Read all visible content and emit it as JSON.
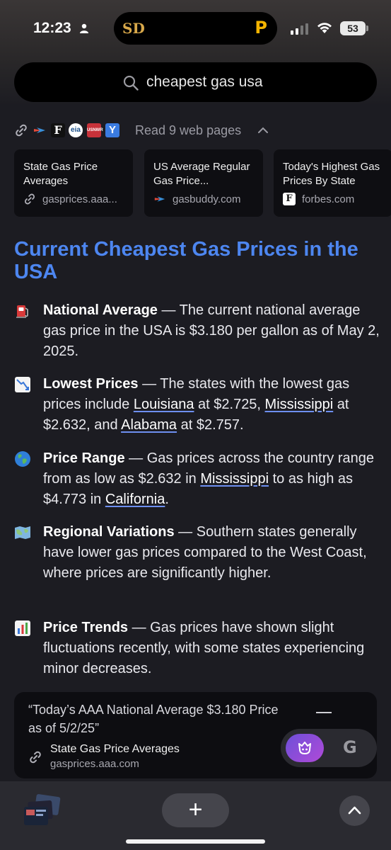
{
  "status_bar": {
    "time": "12:23",
    "battery": "53"
  },
  "search": {
    "query": "cheapest gas usa"
  },
  "sources": {
    "summary": "Read 9 web pages",
    "icons": [
      "link-icon",
      "gasbuddy-icon",
      "forbes-icon",
      "eia-icon",
      "usnews-icon",
      "yahoo-icon"
    ],
    "cards": [
      {
        "title": "State Gas Price Averages",
        "site": "gasprices.aaa..."
      },
      {
        "title": "US Average Regular Gas Price...",
        "site": "gasbuddy.com"
      },
      {
        "title": "Today's Highest Gas Prices By State",
        "site": "forbes.com"
      }
    ]
  },
  "answer": {
    "heading": "Current Cheapest Gas Prices in the USA",
    "items": [
      {
        "icon": "fuel-pump-icon",
        "title": "National Average",
        "text": " — The current national average gas price in the USA is $3.180 per gallon as of May 2, 2025."
      },
      {
        "icon": "chart-decreasing-icon",
        "title": "Lowest Prices",
        "t1": " — The states with the lowest gas prices include ",
        "l1": "Louisiana",
        "t2": " at $2.725, ",
        "l2": "Mississippi",
        "t3": " at $2.632, and ",
        "l3": "Alabama",
        "t4": " at $2.757."
      },
      {
        "icon": "globe-icon",
        "title": "Price Range",
        "t1": " — Gas prices across the country range from as low as $2.632 in ",
        "l1": "Mississippi",
        "t2": " to as high as $4.773 in ",
        "l2": "California",
        "t3": "."
      },
      {
        "icon": "map-icon",
        "title": "Regional Variations",
        "text": " — Southern states generally have lower gas prices compared to the West Coast, where prices are significantly higher."
      },
      {
        "icon": "bar-chart-icon",
        "title": "Price Trends",
        "text": " — Gas prices have shown slight fluctuations recently, with some states experiencing minor decreases."
      }
    ]
  },
  "quote": {
    "text": "“Today’s AAA National Average $3.180 Price as of 5/2/25”",
    "source_title": "State Gas Price Averages",
    "source_site": "gasprices.aaa.com"
  },
  "toggle": {
    "g_label": "G"
  },
  "bottom": {
    "plus": "+"
  }
}
